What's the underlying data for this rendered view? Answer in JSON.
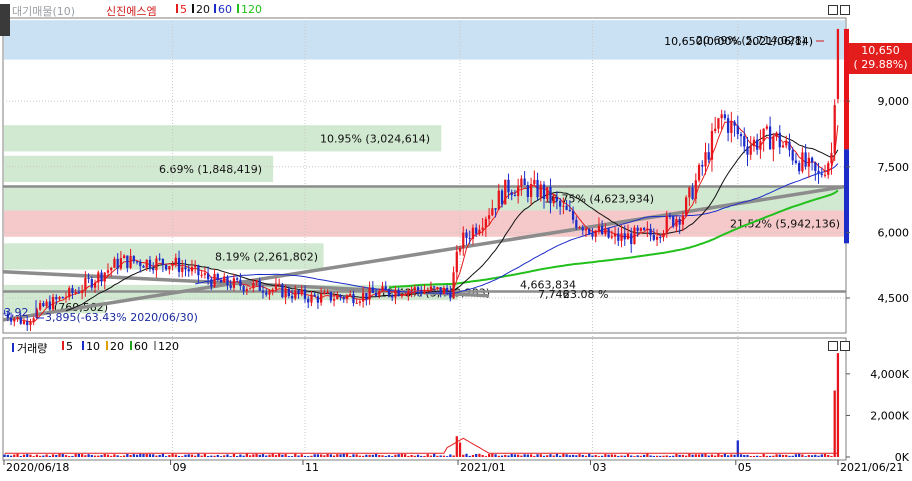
{
  "chart_data": [
    {
      "type": "candlestick",
      "stock_name": "신진에스엠",
      "top_left_label": "대기매물(10)",
      "ma_labels": [
        "5",
        "20",
        "60",
        "120"
      ],
      "colors": {
        "up": "#e8141b",
        "down": "#1c2cc8",
        "ma5": "#e31c1c",
        "ma20": "#111111",
        "ma60": "#1c2cc8",
        "ma120": "#22c01c",
        "trendline": "#8c8c8c",
        "zone_green": "#cfe7cf",
        "zone_pink": "#f4c6c6",
        "zone_blue": "#c7dff2"
      },
      "y_ticks": [
        "9,000",
        "7,500",
        "6,000",
        "4,500"
      ],
      "y_tick_values": [
        9000,
        7500,
        6000,
        4500
      ],
      "ylim": [
        3700,
        10900
      ],
      "x_labels": [
        "2020/06/18",
        "09",
        "11",
        "2021/01",
        "03",
        "05",
        "2021/06/21"
      ],
      "x_label_index": [
        0,
        52,
        93,
        141,
        182,
        227,
        263
      ],
      "bars_total": 258,
      "last_price_badge": "10,650",
      "last_change_badge": "( 29.88%)",
      "top_annotation": "10,650(0.00% 2021/06/14)",
      "low_annotation": "3,895(-63.43% 2020/06/30)",
      "low_left_partial": "3,92",
      "zones": [
        {
          "low": 9950,
          "high": 10850,
          "label": "20.69% (5,714,028)",
          "color": "blue",
          "width_frac": 1.0
        },
        {
          "low": 7850,
          "high": 8450,
          "label": "10.95% (3,024,614)",
          "color": "green",
          "width_frac": 0.52
        },
        {
          "low": 7150,
          "high": 7750,
          "label": "6.69% (1,848,419)",
          "color": "green",
          "width_frac": 0.32
        },
        {
          "low": 6500,
          "high": 7050,
          "label": "16.75% (4,623,934)",
          "color": "green",
          "width_frac": 1.0
        },
        {
          "low": 5900,
          "high": 6500,
          "label": "21.52% (5,942,136)",
          "color": "pink",
          "width_frac": 1.0
        },
        {
          "low": 5150,
          "high": 5750,
          "label": "8.19% (2,261,802)",
          "color": "green",
          "width_frac": 0.38
        },
        {
          "low": 4450,
          "high": 4800,
          "label": "12.48% (3,449,283)",
          "color": "green",
          "width_frac": 0.54
        },
        {
          "low": 4150,
          "high": 4450,
          "label": "(769,562)",
          "color": "green",
          "width_frac": 0.12
        }
      ],
      "extra_overlap_labels": [
        "4,663,834",
        "7,746",
        "23.08 %"
      ],
      "volume_panel": {
        "legend": [
          "거래량",
          "5",
          "10",
          "20",
          "60",
          "120"
        ],
        "legend_colors": [
          "#1c2cc8",
          "#e31c1c",
          "#1c2cc8",
          "#e0a000",
          "#22a01c",
          "#999999"
        ],
        "y_ticks": [
          "4,000K",
          "2,000K",
          "0K"
        ],
        "y_tick_values": [
          4000,
          2000,
          0
        ],
        "ylim": [
          0,
          5100
        ],
        "spikes": [
          {
            "i": 140,
            "v": 1000
          },
          {
            "i": 141,
            "v": 700
          },
          {
            "i": 227,
            "v": 800
          },
          {
            "i": 257,
            "v": 3200
          },
          {
            "i": 258,
            "v": 5000
          }
        ]
      }
    }
  ]
}
